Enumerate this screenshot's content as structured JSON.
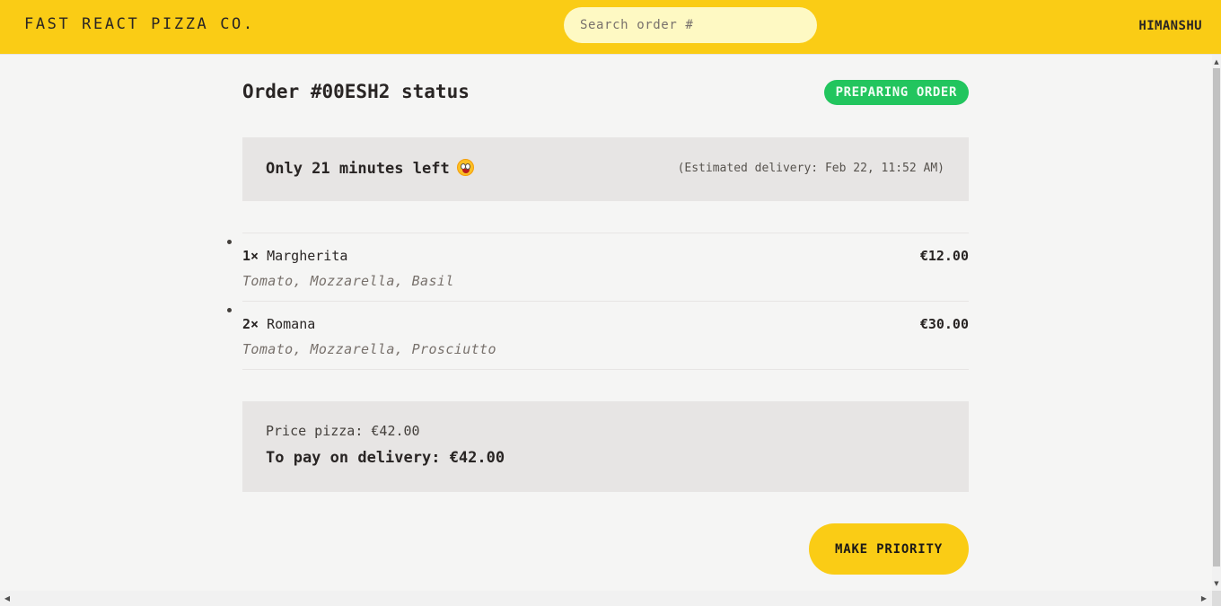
{
  "header": {
    "logo": "FAST REACT PIZZA CO.",
    "search_placeholder": "Search order #",
    "username": "HIMANSHU"
  },
  "order": {
    "title": "Order #00ESH2 status",
    "status_badge": "PREPARING ORDER",
    "time_left": "Only 21 minutes left",
    "emoji_icon": "grinning-face-emoji",
    "eta": "(Estimated delivery: Feb 22, 11:52 AM)"
  },
  "items": [
    {
      "qty": "1×",
      "name": "Margherita",
      "price": "€12.00",
      "ingredients": "Tomato, Mozzarella, Basil"
    },
    {
      "qty": "2×",
      "name": "Romana",
      "price": "€30.00",
      "ingredients": "Tomato, Mozzarella, Prosciutto"
    }
  ],
  "summary": {
    "price_pizza": "Price pizza: €42.00",
    "to_pay": "To pay on delivery: €42.00"
  },
  "actions": {
    "priority_label": "MAKE PRIORITY"
  },
  "colors": {
    "accent": "#facc15",
    "status": "#22c55e",
    "background": "#f5f5f4",
    "panel": "#e7e5e4"
  },
  "scrollbars": {
    "up_arrow": "▲",
    "down_arrow": "▼",
    "left_arrow": "◀",
    "right_arrow": "▶"
  }
}
